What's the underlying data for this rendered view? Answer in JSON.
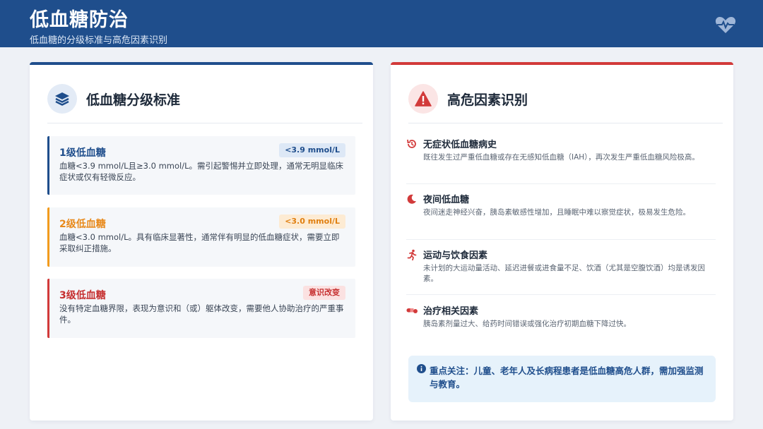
{
  "header": {
    "title": "低血糖防治",
    "subtitle": "低血糖的分级标准与高危因素识别"
  },
  "left_card": {
    "title": "低血糖分级标准",
    "icon": "layers-icon",
    "levels": [
      {
        "name": "1级低血糖",
        "badge": "<3.9 mmol/L",
        "description": "血糖<3.9 mmol/L且≥3.0 mmol/L。需引起警惕并立即处理，通常无明显临床症状或仅有轻微反应。",
        "color": "#1f4e8c"
      },
      {
        "name": "2级低血糖",
        "badge": "<3.0 mmol/L",
        "description": "血糖<3.0 mmol/L。具有临床显著性，通常伴有明显的低血糖症状，需要立即采取纠正措施。",
        "color": "#f29b1d"
      },
      {
        "name": "3级低血糖",
        "badge": "意识改变",
        "description": "没有特定血糖界限，表现为意识和（或）躯体改变，需要他人协助治疗的严重事件。",
        "color": "#d23a3a"
      }
    ]
  },
  "right_card": {
    "title": "高危因素识别",
    "icon": "warning-triangle-icon",
    "factors": [
      {
        "name": "无症状低血糖病史",
        "icon": "history-icon",
        "description": "既往发生过严重低血糖或存在无感知低血糖（IAH），再次发生严重低血糖风险极高。"
      },
      {
        "name": "夜间低血糖",
        "icon": "moon-icon",
        "description": "夜间迷走神经兴奋，胰岛素敏感性增加，且睡眠中难以察觉症状，极易发生危险。"
      },
      {
        "name": "运动与饮食因素",
        "icon": "running-icon",
        "description": "未计划的大运动量活动、延迟进餐或进食量不足、饮酒（尤其是空腹饮酒）均是诱发因素。"
      },
      {
        "name": "治疗相关因素",
        "icon": "pills-icon",
        "description": "胰岛素剂量过大、给药时间错误或强化治疗初期血糖下降过快。"
      }
    ],
    "note": "重点关注：儿童、老年人及长病程患者是低血糖高危人群，需加强监测与教育。"
  },
  "colors": {
    "primary": "#1f4e8c",
    "danger": "#d23a3a",
    "warning": "#f29b1d"
  }
}
